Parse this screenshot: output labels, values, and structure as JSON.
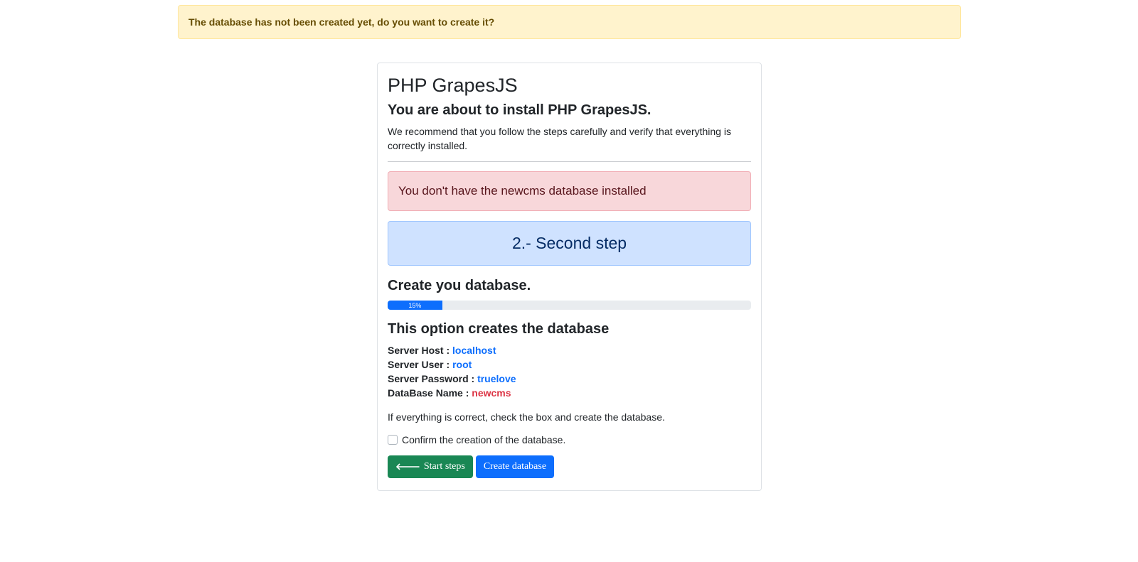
{
  "banner": {
    "message": "The database has not been created yet, do you want to create it?"
  },
  "card": {
    "title": "PHP GrapesJS",
    "subtitle": "You are about to install PHP GrapesJS.",
    "intro": "We recommend that you follow the steps carefully and verify that everything is correctly installed.",
    "alert": "You don't have the newcms database installed",
    "step_label": "2.- Second step",
    "section_heading": "Create you database.",
    "progress": {
      "percent": 15,
      "label": "15%"
    },
    "option_heading": "This option creates the database",
    "info": [
      {
        "label": "Server Host :",
        "value": "localhost",
        "color": "#0d6efd"
      },
      {
        "label": "Server User :",
        "value": "root",
        "color": "#0d6efd"
      },
      {
        "label": "Server Password :",
        "value": "truelove",
        "color": "#0d6efd"
      },
      {
        "label": "DataBase Name :",
        "value": "newcms",
        "color": "#dc3545"
      }
    ],
    "check_note": "If everything is correct, check the box and create the database.",
    "checkbox_label": "Confirm the creation of the database.",
    "checkbox_checked": false,
    "buttons": {
      "start_steps": "Start steps",
      "start_steps_icon": "arrow-left-icon",
      "create_database": "Create database"
    }
  },
  "colors": {
    "warning_bg": "#fff3cd",
    "danger_bg": "#f8d7da",
    "info_bg": "#cfe2ff",
    "primary": "#0d6efd",
    "success": "#198754",
    "danger_text": "#dc3545"
  }
}
